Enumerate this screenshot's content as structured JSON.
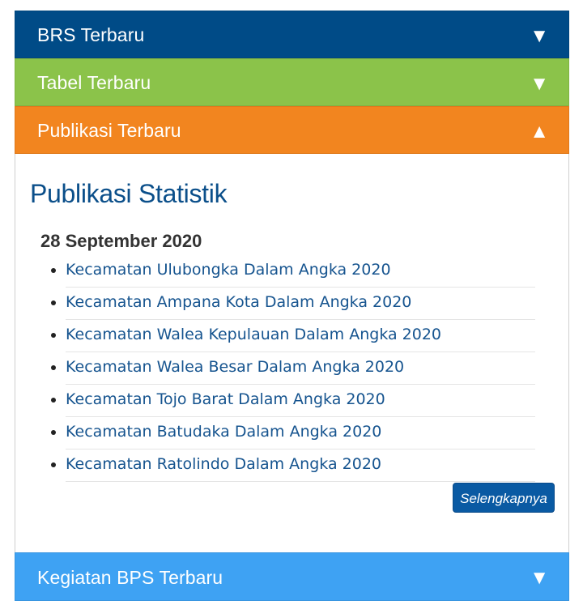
{
  "colors": {
    "brs": "#004b87",
    "tabel": "#8bc34a",
    "publikasi": "#f2851f",
    "kegiatan": "#3ea2f3"
  },
  "accordion": {
    "items": [
      {
        "label": "BRS Terbaru",
        "arrow": "▼"
      },
      {
        "label": "Tabel Terbaru",
        "arrow": "▼"
      },
      {
        "label": "Publikasi Terbaru",
        "arrow": "▲"
      },
      {
        "label": "Kegiatan BPS Terbaru",
        "arrow": "▼"
      }
    ]
  },
  "publikasi": {
    "title": "Publikasi Statistik",
    "date": "28 September 2020",
    "items": [
      "Kecamatan Ulubongka Dalam Angka 2020",
      "Kecamatan Ampana Kota Dalam Angka 2020",
      "Kecamatan Walea Kepulauan Dalam Angka 2020",
      "Kecamatan Walea Besar Dalam Angka 2020",
      "Kecamatan Tojo Barat Dalam Angka 2020",
      "Kecamatan Batudaka Dalam Angka 2020",
      "Kecamatan Ratolindo Dalam Angka 2020"
    ],
    "more_label": "Selengkapnya"
  }
}
